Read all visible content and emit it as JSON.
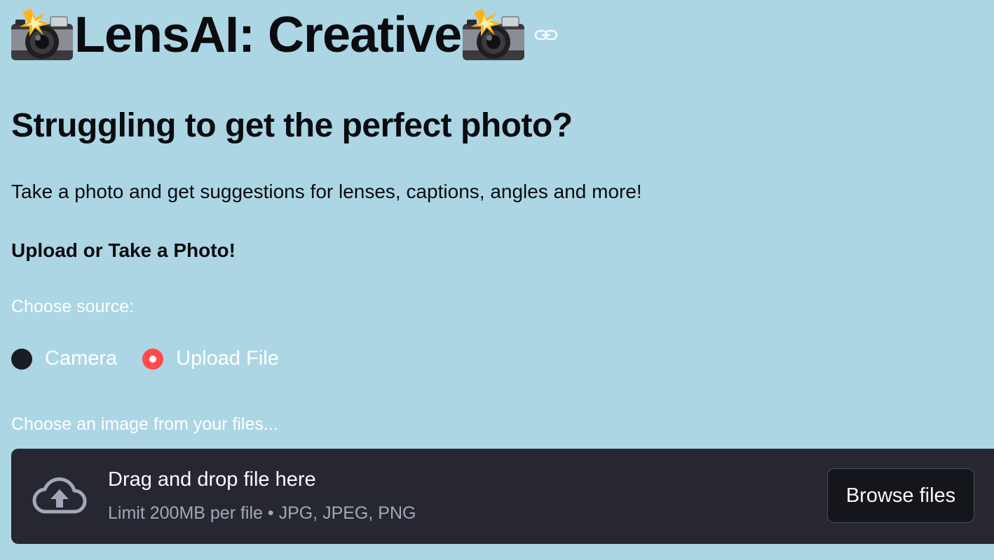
{
  "app": {
    "title": "LensAI: Creative",
    "title_emoji": "camera-with-flash-icon"
  },
  "intro": {
    "subtitle": "Struggling to get the perfect photo?",
    "tagline": "Take a photo and get suggestions for lenses, captions, angles and more!",
    "upload_heading": "Upload or Take a Photo!"
  },
  "source": {
    "label": "Choose source:",
    "options": [
      {
        "label": "Camera",
        "selected": false
      },
      {
        "label": "Upload File",
        "selected": true
      }
    ]
  },
  "uploader": {
    "label": "Choose an image from your files...",
    "drop_title": "Drag and drop file here",
    "limit_text": "Limit 200MB per file • JPG, JPEG, PNG",
    "browse_label": "Browse files",
    "icon": "cloud-upload-icon"
  },
  "colors": {
    "background": "#acd6e4",
    "accent": "#ff4b4b",
    "dropzone": "#262730",
    "button": "#15161c"
  }
}
